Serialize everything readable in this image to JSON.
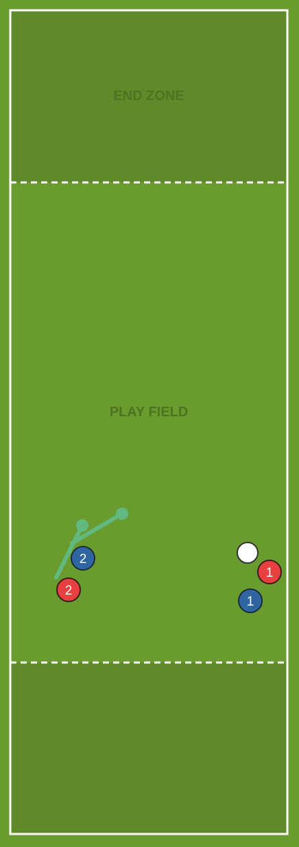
{
  "colors": {
    "grass": "#6a9b2e",
    "end_zone": "#5f8a29",
    "lines": "#ffffff",
    "zone_label": "#4e7321",
    "team_red": "#e84040",
    "team_blue": "#2f66a1",
    "disc": "#ffffff",
    "path": "#5fc49a"
  },
  "zones": {
    "end_zone_label": "END ZONE",
    "play_field_label": "PLAY FIELD"
  },
  "players": {
    "red_1": {
      "number": "1",
      "team": "red"
    },
    "red_2": {
      "number": "2",
      "team": "red"
    },
    "blue_1": {
      "number": "1",
      "team": "blue"
    },
    "blue_2": {
      "number": "2",
      "team": "blue"
    }
  },
  "disc": {
    "name": "disc"
  }
}
